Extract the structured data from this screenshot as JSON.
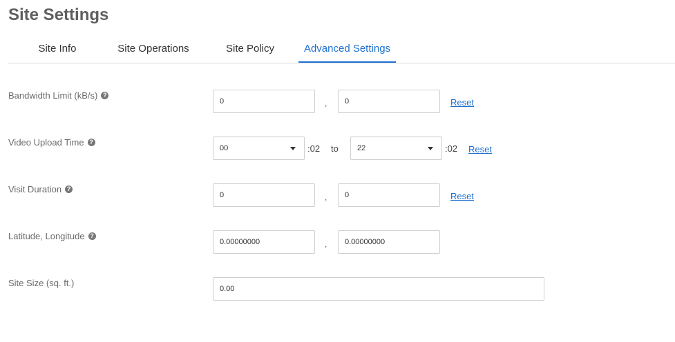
{
  "page_title": "Site Settings",
  "tabs": [
    {
      "label": "Site Info"
    },
    {
      "label": "Site Operations"
    },
    {
      "label": "Site Policy"
    },
    {
      "label": "Advanced Settings",
      "active": true
    }
  ],
  "bandwidth": {
    "label": "Bandwidth Limit (kB/s)",
    "value1": "0",
    "separator": ",",
    "value2": "0",
    "reset": "Reset"
  },
  "upload_time": {
    "label": "Video Upload Time",
    "from_hour": "00",
    "from_suffix": ":02",
    "to": "to",
    "to_hour": "22",
    "to_suffix": ":02",
    "reset": "Reset"
  },
  "visit_duration": {
    "label": "Visit Duration",
    "value1": "0",
    "separator": ",",
    "value2": "0",
    "reset": "Reset"
  },
  "lat_long": {
    "label": "Latitude, Longitude",
    "latitude": "0.00000000",
    "separator": ",",
    "longitude": "0.00000000"
  },
  "site_size": {
    "label": "Site Size (sq. ft.)",
    "value": "0.00"
  },
  "help_glyph": "?",
  "colors": {
    "accent": "#1f6fd0",
    "border": "#cfcfcf",
    "title": "#5f5f5f"
  }
}
